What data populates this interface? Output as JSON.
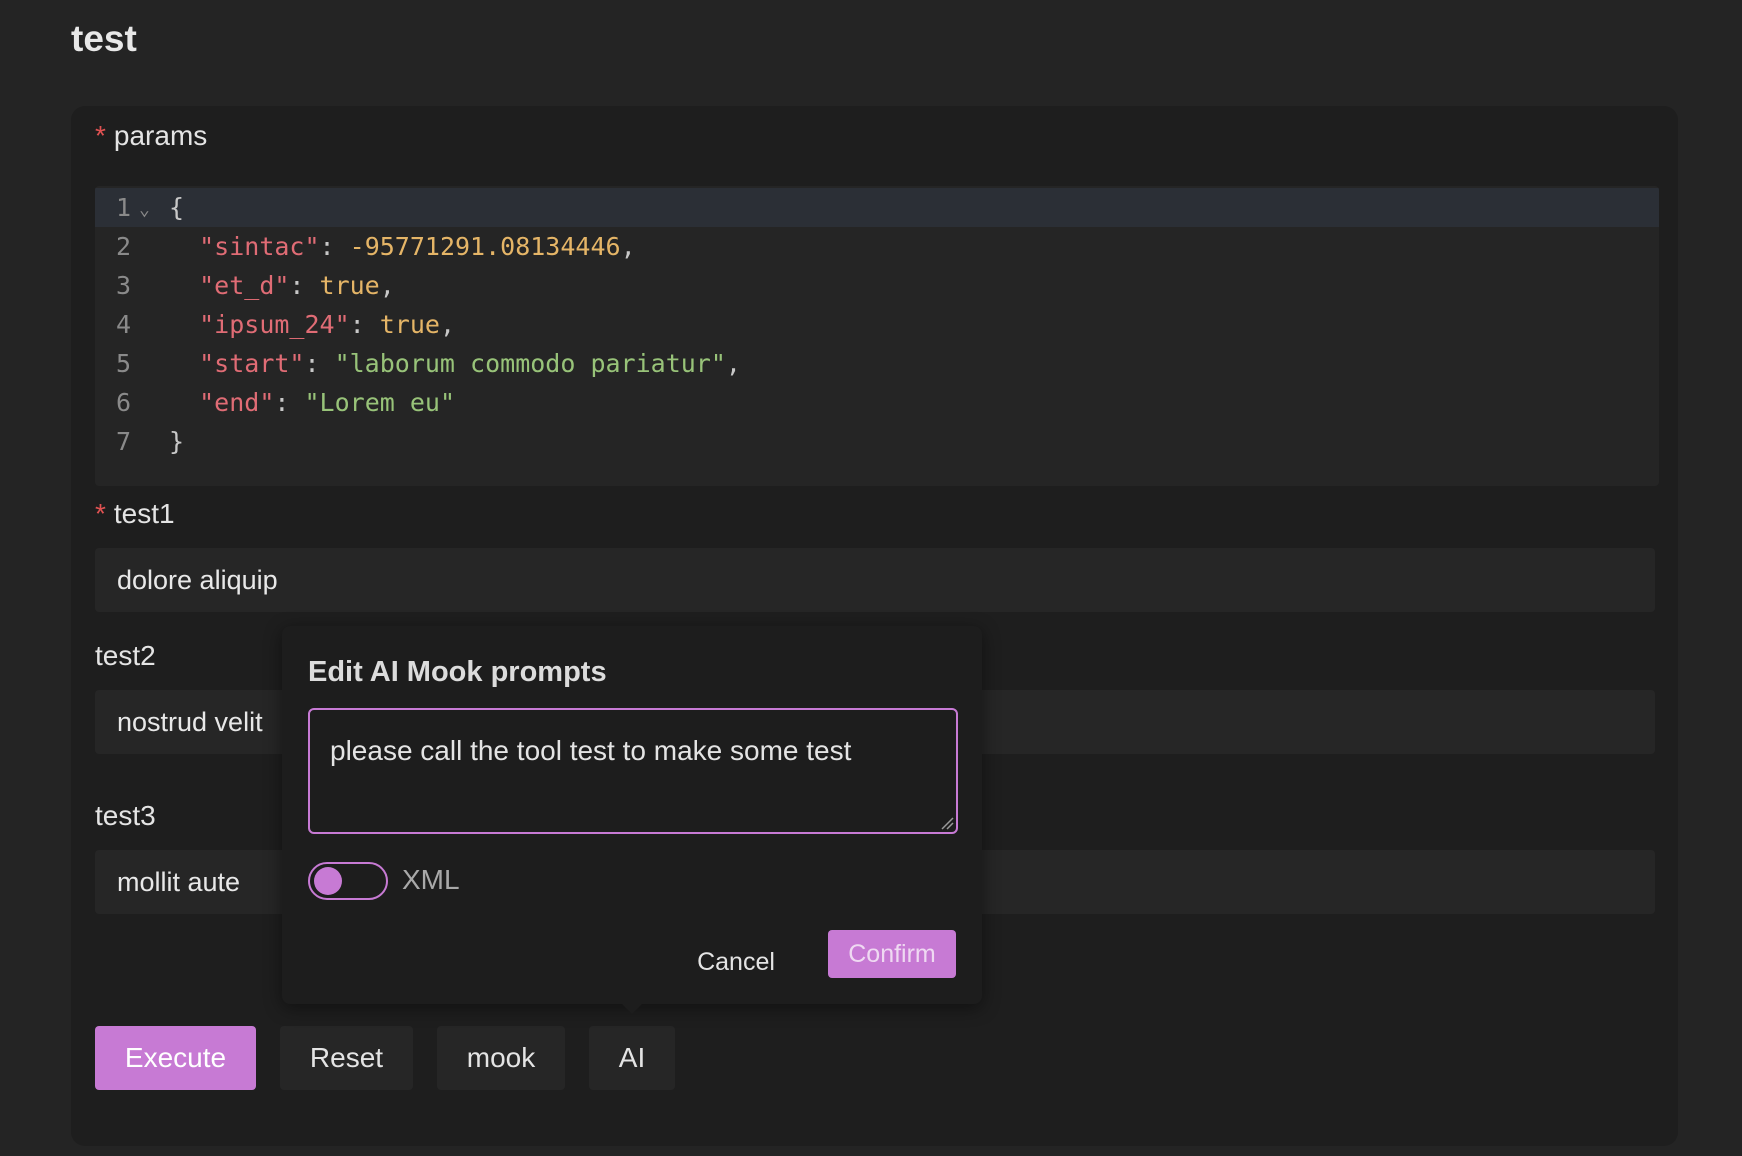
{
  "page": {
    "title": "test"
  },
  "form": {
    "params": {
      "label": "params",
      "required_mark": "*",
      "lines": [
        {
          "no": "1",
          "tokens": [
            {
              "t": "p",
              "v": "{"
            }
          ]
        },
        {
          "no": "2",
          "tokens": [
            {
              "t": "p",
              "v": "  "
            },
            {
              "t": "key",
              "v": "\"sintac\""
            },
            {
              "t": "p",
              "v": ": "
            },
            {
              "t": "num",
              "v": "-95771291.08134446"
            },
            {
              "t": "p",
              "v": ","
            }
          ]
        },
        {
          "no": "3",
          "tokens": [
            {
              "t": "p",
              "v": "  "
            },
            {
              "t": "key",
              "v": "\"et_d\""
            },
            {
              "t": "p",
              "v": ": "
            },
            {
              "t": "bool",
              "v": "true"
            },
            {
              "t": "p",
              "v": ","
            }
          ]
        },
        {
          "no": "4",
          "tokens": [
            {
              "t": "p",
              "v": "  "
            },
            {
              "t": "key",
              "v": "\"ipsum_24\""
            },
            {
              "t": "p",
              "v": ": "
            },
            {
              "t": "bool",
              "v": "true"
            },
            {
              "t": "p",
              "v": ","
            }
          ]
        },
        {
          "no": "5",
          "tokens": [
            {
              "t": "p",
              "v": "  "
            },
            {
              "t": "key",
              "v": "\"start\""
            },
            {
              "t": "p",
              "v": ": "
            },
            {
              "t": "str",
              "v": "\"laborum commodo pariatur\""
            },
            {
              "t": "p",
              "v": ","
            }
          ]
        },
        {
          "no": "6",
          "tokens": [
            {
              "t": "p",
              "v": "  "
            },
            {
              "t": "key",
              "v": "\"end\""
            },
            {
              "t": "p",
              "v": ": "
            },
            {
              "t": "str",
              "v": "\"Lorem eu\""
            }
          ]
        },
        {
          "no": "7",
          "tokens": [
            {
              "t": "p",
              "v": "}"
            }
          ]
        }
      ]
    },
    "test1": {
      "label": "test1",
      "required_mark": "*",
      "value": "dolore aliquip"
    },
    "test2": {
      "label": "test2",
      "value": "nostrud velit"
    },
    "test3": {
      "label": "test3",
      "value": "mollit aute"
    }
  },
  "actions": {
    "execute": "Execute",
    "reset": "Reset",
    "mook": "mook",
    "ai": "AI"
  },
  "popover": {
    "title": "Edit AI Mook prompts",
    "prompt_value": "please call the tool test to make some test",
    "toggle_label": "XML",
    "toggle_on": false,
    "cancel": "Cancel",
    "confirm": "Confirm"
  },
  "colors": {
    "accent": "#c77ad4",
    "required": "#e05252",
    "background": "#242424",
    "card": "#1e1e1e"
  },
  "icons": {
    "fold": "chevron-down-icon",
    "resize": "resize-grip-icon"
  }
}
